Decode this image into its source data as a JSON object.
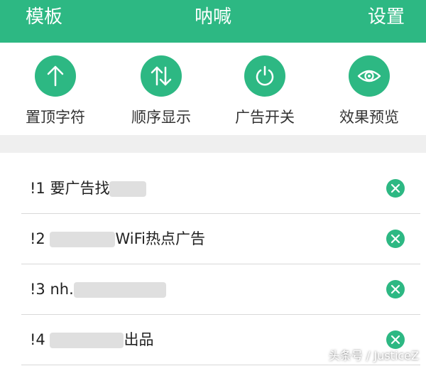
{
  "header": {
    "left_label": "模板",
    "title": "呐喊",
    "right_label": "设置"
  },
  "actions": [
    {
      "label": "置顶字符",
      "icon": "arrow-up-icon"
    },
    {
      "label": "顺序显示",
      "icon": "sort-arrows-icon"
    },
    {
      "label": "广告开关",
      "icon": "power-icon"
    },
    {
      "label": "效果预览",
      "icon": "eye-icon"
    }
  ],
  "list": {
    "items": [
      {
        "prefix": "!1",
        "text": "要广告找"
      },
      {
        "prefix": "!2",
        "text": "WiFi热点广告"
      },
      {
        "prefix": "!3",
        "text": "nh."
      },
      {
        "prefix": "!4",
        "text": "出品"
      }
    ]
  },
  "watermark": "头条号 / JusticeZ",
  "colors": {
    "accent": "#2db883",
    "divider": "#efefef"
  }
}
